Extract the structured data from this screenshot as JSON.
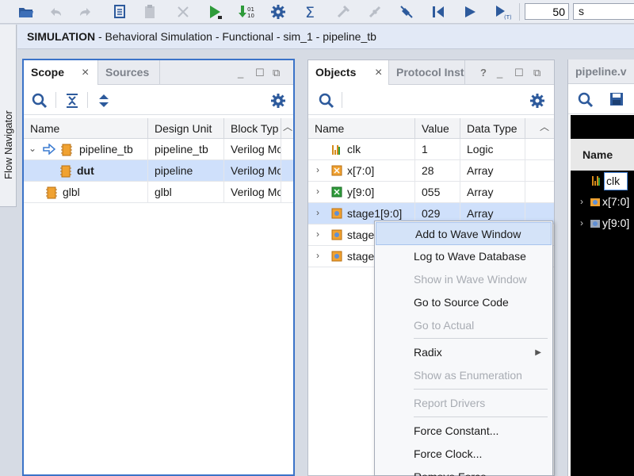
{
  "toolbar": {
    "time_value": "50",
    "time_unit": "s",
    "icons": [
      "open-folder-icon",
      "undo-icon",
      "redo-icon",
      "copy-icon",
      "paste-icon",
      "delete-icon",
      "run-all-icon",
      "run-for-icon",
      "settings-icon",
      "sum-icon",
      "disabled-tool-icon",
      "disabled-tool2-icon",
      "break-icon",
      "restart-icon",
      "run-icon",
      "step-icon"
    ]
  },
  "title": {
    "prefix": "SIMULATION",
    "rest": " - Behavioral Simulation - Functional - sim_1 - pipeline_tb"
  },
  "flow_navigator": {
    "label": "Flow Navigator"
  },
  "scope_panel": {
    "tabs": [
      {
        "label": "Scope",
        "active": true
      },
      {
        "label": "Sources",
        "active": false
      }
    ],
    "columns": [
      "Name",
      "Design Unit",
      "Block Typ"
    ],
    "rows": [
      {
        "name": "pipeline_tb",
        "unit": "pipeline_tb",
        "type": "Verilog Mo"
      },
      {
        "name": "dut",
        "unit": "pipeline",
        "type": "Verilog Mo"
      },
      {
        "name": "glbl",
        "unit": "glbl",
        "type": "Verilog Mo"
      }
    ]
  },
  "objects_panel": {
    "tabs": [
      {
        "label": "Objects",
        "active": true
      },
      {
        "label": "Protocol Inst",
        "active": false
      }
    ],
    "help": "?",
    "columns": [
      "Name",
      "Value",
      "Data Type"
    ],
    "rows": [
      {
        "name": "clk",
        "value": "1",
        "type": "Logic"
      },
      {
        "name": "x[7:0]",
        "value": "28",
        "type": "Array"
      },
      {
        "name": "y[9:0]",
        "value": "055",
        "type": "Array"
      },
      {
        "name": "stage1[9:0]",
        "value": "029",
        "type": "Array"
      },
      {
        "name": "stage",
        "value": "",
        "type": ""
      },
      {
        "name": "stage",
        "value": "",
        "type": ""
      }
    ]
  },
  "wave_panel": {
    "tab": "pipeline.v",
    "column": "Name",
    "rows": [
      "clk",
      "x[7:0]",
      "y[9:0]"
    ]
  },
  "context_menu": {
    "items": [
      {
        "label": "Add to Wave Window",
        "state": "highlighted"
      },
      {
        "label": "Log to Wave Database",
        "state": "enabled"
      },
      {
        "label": "Show in Wave Window",
        "state": "disabled"
      },
      {
        "label": "Go to Source Code",
        "state": "enabled"
      },
      {
        "label": "Go to Actual",
        "state": "disabled"
      },
      {
        "label": "Radix",
        "state": "submenu"
      },
      {
        "label": "Show as Enumeration",
        "state": "disabled"
      },
      {
        "label": "Report Drivers",
        "state": "disabled"
      },
      {
        "label": "Force Constant...",
        "state": "enabled"
      },
      {
        "label": "Force Clock...",
        "state": "enabled"
      },
      {
        "label": "Remove Force",
        "state": "enabled"
      }
    ]
  }
}
